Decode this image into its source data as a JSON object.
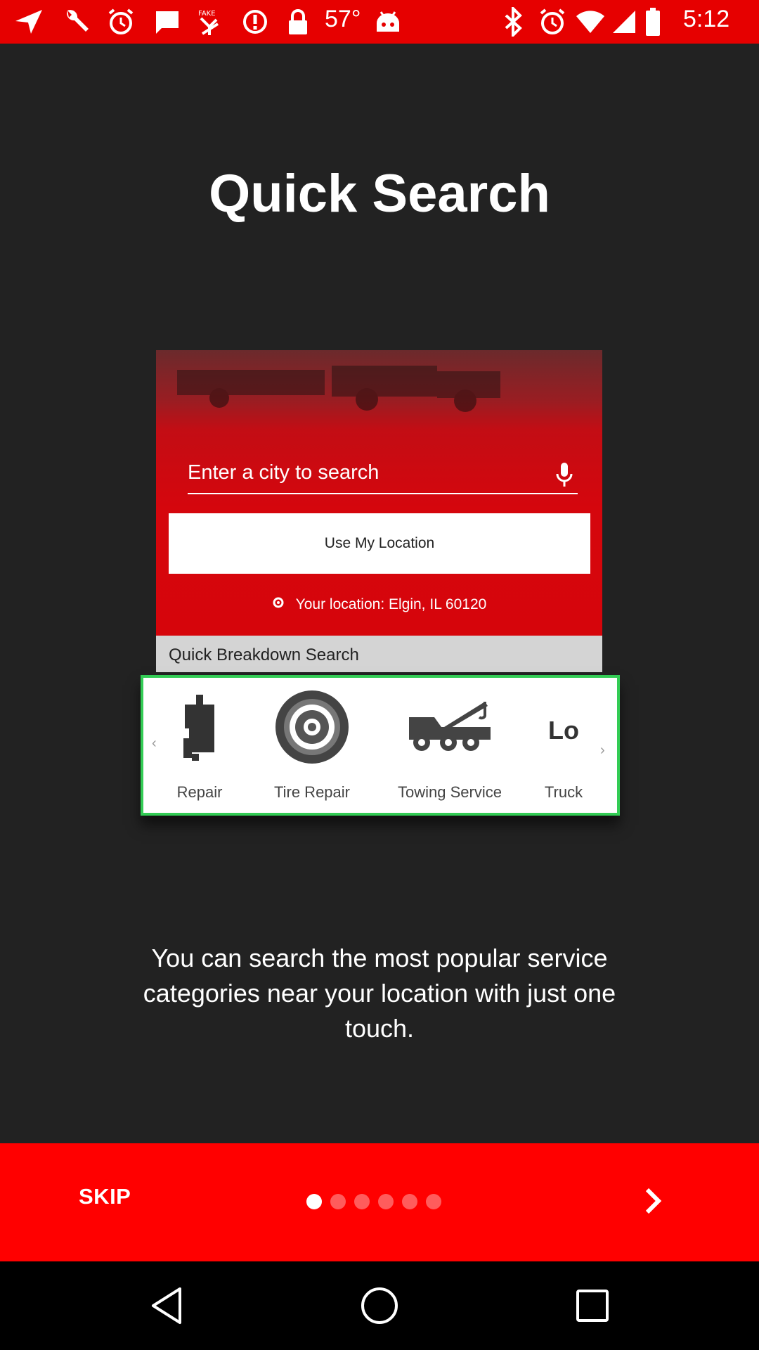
{
  "status_bar": {
    "temperature": "57°",
    "time": "5:12",
    "icons": [
      "navigation-icon",
      "wrench-icon",
      "alarm-icon",
      "message-icon",
      "fake-gps-icon",
      "warning-icon",
      "lock-icon",
      "android-icon",
      "bluetooth-icon",
      "alarm-icon",
      "wifi-icon",
      "signal-icon",
      "battery-icon"
    ]
  },
  "page": {
    "title": "Quick Search",
    "description": "You can search the most popular service categories near your location with just one touch."
  },
  "illustration": {
    "search_placeholder": "Enter a city to search",
    "use_location_label": "Use My Location",
    "location_text": "Your location: Elgin, IL 60120",
    "section_label": "Quick Breakdown Search",
    "categories": [
      {
        "label": "Repair",
        "icon": "truck-repair-icon"
      },
      {
        "label": "Tire Repair",
        "icon": "tire-icon"
      },
      {
        "label": "Towing Service",
        "icon": "tow-truck-icon"
      },
      {
        "label": "Truck",
        "icon": "truck-lo-icon",
        "icon_text": "Lo"
      }
    ]
  },
  "bottom_bar": {
    "skip_label": "SKIP",
    "page_count": 6,
    "current_page": 1
  },
  "colors": {
    "background": "#222222",
    "accent_red": "#ff0000",
    "status_bar": "#e60000",
    "highlight_green": "#33cc55"
  }
}
